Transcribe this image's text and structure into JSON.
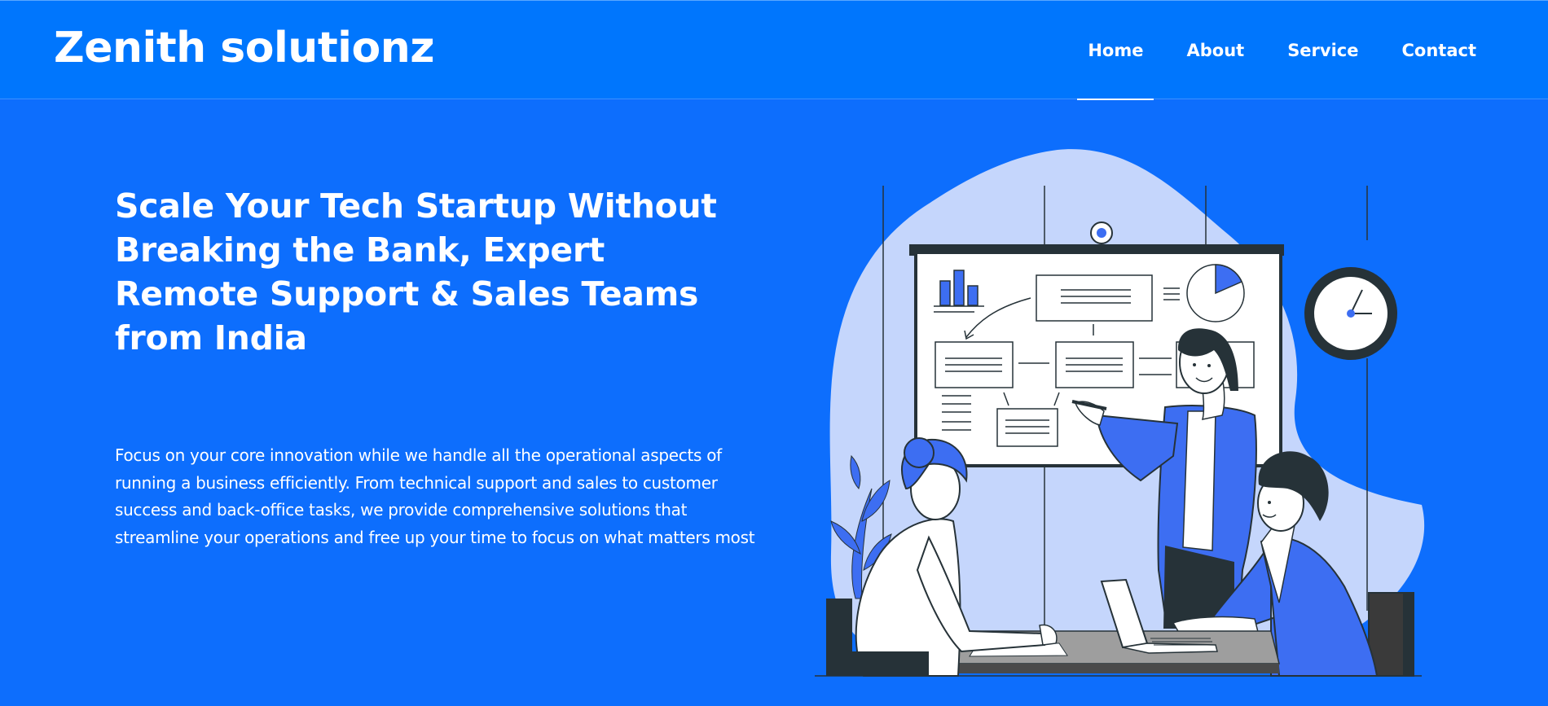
{
  "brand": {
    "name": "Zenith solutionz"
  },
  "nav": {
    "items": [
      {
        "label": "Home",
        "active": true
      },
      {
        "label": "About",
        "active": false
      },
      {
        "label": "Service",
        "active": false
      },
      {
        "label": "Contact",
        "active": false
      }
    ]
  },
  "hero": {
    "title": "Scale Your Tech Startup Without Breaking the Bank, Expert Remote Support & Sales Teams from India",
    "description": "Focus on your core innovation while we handle all the operational aspects of running a business efficiently. From technical support and sales to customer success and back-office tasks, we provide comprehensive solutions that streamline your operations and free up your time to focus on what matters most",
    "illustration": "presentation-meeting-illustration"
  },
  "colors": {
    "navbar": "#0076fd",
    "hero_background": "#0d6efd",
    "text": "#ffffff",
    "blob": "#c5d6fc",
    "illustration_blue": "#3d6ef2",
    "dark": "#263238"
  }
}
